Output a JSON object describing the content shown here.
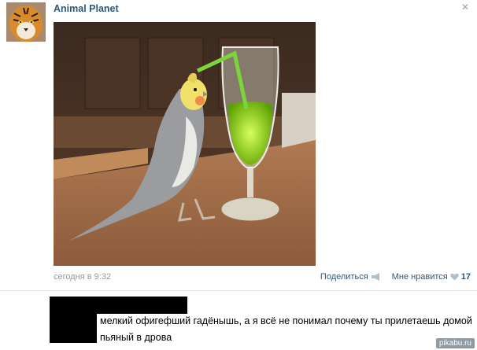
{
  "post": {
    "author": "Animal Planet",
    "close_icon": "close-icon",
    "timestamp": "сегодня в 9:32",
    "share_label": "Поделиться",
    "like_label": "Мне нравится",
    "like_count": "17"
  },
  "comment": {
    "text": "мелкий офигефший гадёнышь, а я всё не понимал почему ты прилетаешь домой пьяный в дрова"
  },
  "watermark": "pikabu.ru",
  "colors": {
    "link": "#2b587a",
    "muted": "#999999",
    "drink": "#8fd400",
    "wood": "#9a6a45"
  }
}
